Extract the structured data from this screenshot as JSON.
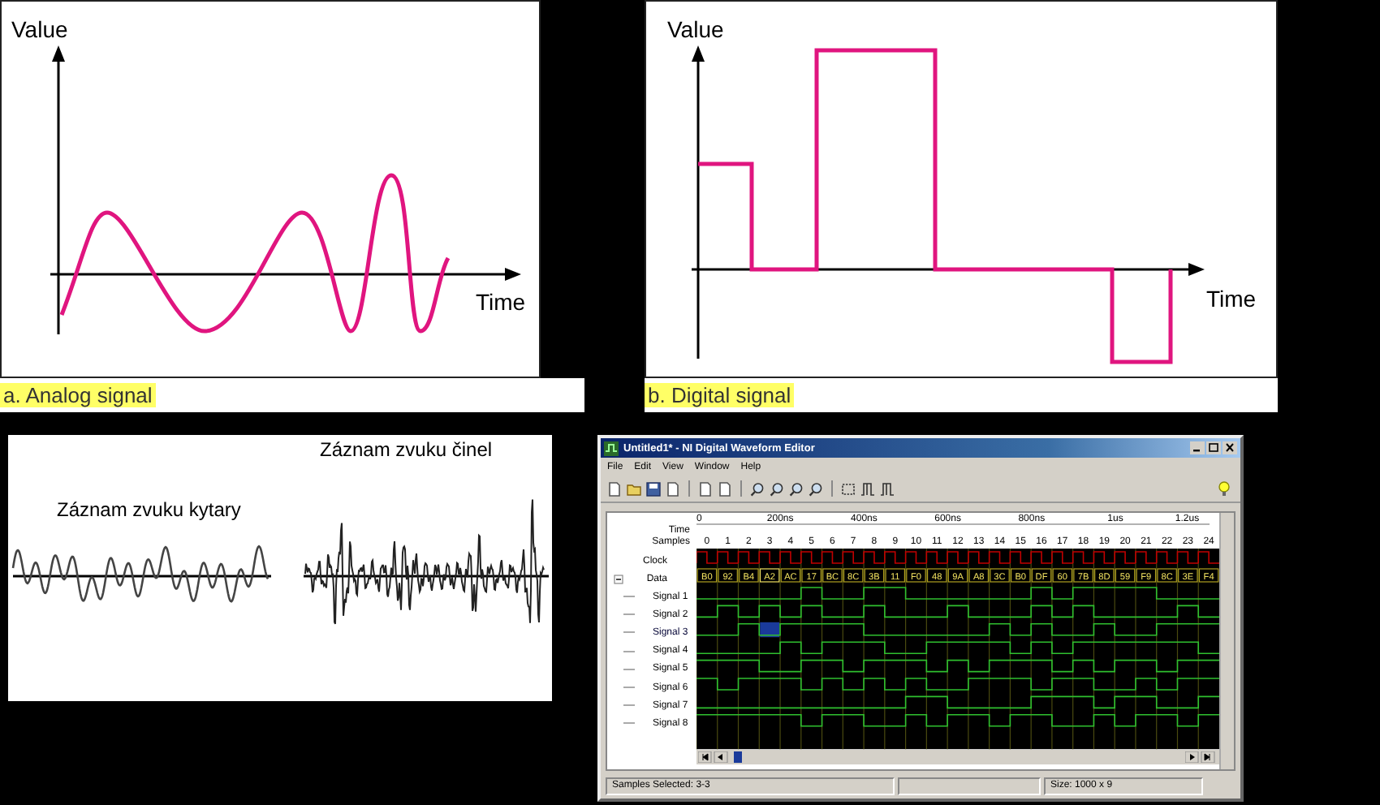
{
  "analog_panel": {
    "y_axis_label": "Value",
    "x_axis_label": "Time",
    "caption": "a. Analog signal"
  },
  "digital_panel": {
    "y_axis_label": "Value",
    "x_axis_label": "Time",
    "caption": "b. Digital signal"
  },
  "sound_panel": {
    "guitar_label": "Záznam zvuku kytary",
    "cymbal_label": "Záznam zvuku činel"
  },
  "editor": {
    "title": "Untitled1* - NI Digital Waveform Editor",
    "menu": [
      "File",
      "Edit",
      "View",
      "Window",
      "Help"
    ],
    "header_labels": [
      "Time",
      "Samples"
    ],
    "time_ticks": [
      "0",
      "200ns",
      "400ns",
      "600ns",
      "800ns",
      "1us",
      "1.2us"
    ],
    "samples": [
      "0",
      "1",
      "2",
      "3",
      "4",
      "5",
      "6",
      "7",
      "8",
      "9",
      "10",
      "11",
      "12",
      "13",
      "14",
      "15",
      "16",
      "17",
      "18",
      "19",
      "20",
      "21",
      "22",
      "23",
      "24"
    ],
    "clock_label": "Clock",
    "data_label": "Data",
    "data": [
      {
        "value": "B0",
        "selected": false
      },
      {
        "value": "92",
        "selected": false
      },
      {
        "value": "B4",
        "selected": false
      },
      {
        "value": "A2",
        "selected": true
      },
      {
        "value": "AC",
        "selected": false
      },
      {
        "value": "17",
        "selected": false
      },
      {
        "value": "BC",
        "selected": false
      },
      {
        "value": "8C",
        "selected": false
      },
      {
        "value": "3B",
        "selected": false
      },
      {
        "value": "11",
        "selected": false
      },
      {
        "value": "F0",
        "selected": false
      },
      {
        "value": "48",
        "selected": false
      },
      {
        "value": "9A",
        "selected": false
      },
      {
        "value": "A8",
        "selected": false
      },
      {
        "value": "3C",
        "selected": false
      },
      {
        "value": "B0",
        "selected": false
      },
      {
        "value": "DF",
        "selected": false
      },
      {
        "value": "60",
        "selected": false
      },
      {
        "value": "7B",
        "selected": false
      },
      {
        "value": "8D",
        "selected": false
      },
      {
        "value": "59",
        "selected": false
      },
      {
        "value": "F9",
        "selected": false
      },
      {
        "value": "8C",
        "selected": false
      },
      {
        "value": "3E",
        "selected": false
      },
      {
        "value": "F4",
        "selected": false
      }
    ],
    "signals": [
      {
        "name": "Signal 1",
        "selected": false
      },
      {
        "name": "Signal 2",
        "selected": false
      },
      {
        "name": "Signal 3",
        "selected": true
      },
      {
        "name": "Signal 4",
        "selected": false
      },
      {
        "name": "Signal 5",
        "selected": false
      },
      {
        "name": "Signal 6",
        "selected": false
      },
      {
        "name": "Signal 7",
        "selected": false
      },
      {
        "name": "Signal 8",
        "selected": false
      }
    ],
    "status": [
      "Samples Selected: 3-3",
      "Size: 1000 x 9"
    ]
  }
}
